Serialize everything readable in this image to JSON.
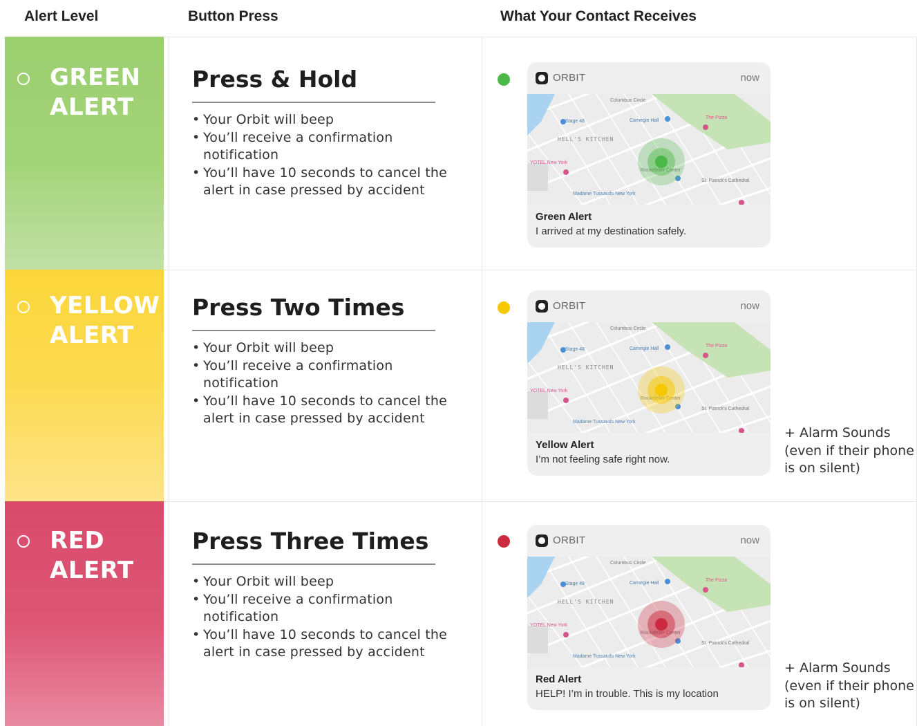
{
  "headers": {
    "alert_level": "Alert Level",
    "button_press": "Button Press",
    "contact_receives": "What Your Contact Receives"
  },
  "rows": [
    {
      "level_line1": "GREEN",
      "level_line2": "ALERT",
      "press_title": "Press & Hold",
      "bullets": [
        "Your Orbit will beep",
        "You’ll receive a confirmation notification",
        "You’ll have 10 seconds to cancel the alert in case pressed by accident"
      ],
      "notif": {
        "app": "ORBIT",
        "time": "now",
        "title": "Green Alert",
        "message": "I arrived at my destination safely."
      },
      "extra": ""
    },
    {
      "level_line1": "YELLOW",
      "level_line2": "ALERT",
      "press_title": "Press Two Times",
      "bullets": [
        "Your Orbit will beep",
        "You’ll receive a confirmation notification",
        "You’ll have 10 seconds to cancel the alert in case pressed by accident"
      ],
      "notif": {
        "app": "ORBIT",
        "time": "now",
        "title": "Yellow Alert",
        "message": "I’m not feeling safe right now."
      },
      "extra": "+ Alarm Sounds (even if their phone is on silent)"
    },
    {
      "level_line1": "RED",
      "level_line2": "ALERT",
      "press_title": "Press Three Times",
      "bullets": [
        "Your Orbit will beep",
        "You’ll receive a confirmation notification",
        "You’ll have 10 seconds to cancel the alert in case pressed by accident"
      ],
      "notif": {
        "app": "ORBIT",
        "time": "now",
        "title": "Red Alert",
        "message": "HELP! I’m in trouble. This is my location"
      },
      "extra": "+ Alarm Sounds (even if their phone is on silent)"
    }
  ],
  "map_labels": {
    "columbus": "Columbus Circle",
    "stage": "Stage 48",
    "carnegie": "Carnegie Hall",
    "hells_kitchen": "HELL'S KITCHEN",
    "yotel": "YOTEL New York",
    "rockefeller": "Rockefeller Center",
    "st_patricks": "St. Patrick's Cathedral",
    "tussauds": "Madame Tussauds New York",
    "the_pizza": "The Pizza"
  },
  "colors": {
    "green": "#4cb848",
    "yellow": "#f5c800",
    "red": "#cc2a3e",
    "green_band_top": "#9bcf6f",
    "green_band_bottom": "#c2e0a6",
    "yellow_band_top": "#fbd63a",
    "yellow_band_bottom": "#fde38a",
    "red_band_top": "#d94a6a",
    "red_band_bottom": "#e98aa2"
  },
  "icons": {
    "level_marker": "ring-icon",
    "contact_dot": "status-dot-icon",
    "app_logo": "orbit-logo-icon",
    "map_marker": "pin-icon"
  }
}
